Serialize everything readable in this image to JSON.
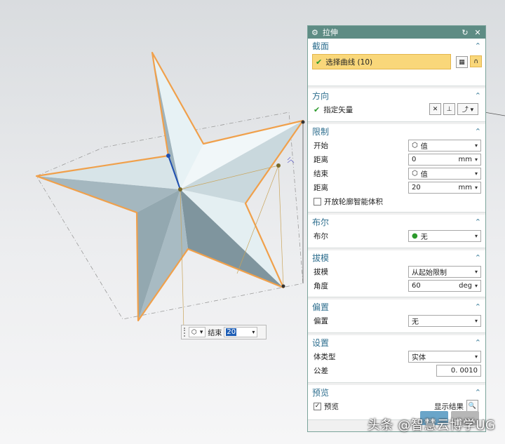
{
  "colors": {
    "title_bar": "#5e8c84",
    "section_header": "#2f6f8f",
    "highlight": "#f9d77a",
    "edge": "#f0a04b",
    "face_light": "#e9f3f6",
    "face_dark": "#8fa5ae"
  },
  "float_box": {
    "type_icon": "cube-icon",
    "label": "结束",
    "value": "20"
  },
  "dialog": {
    "title": "拉伸",
    "sections": {
      "section": {
        "header": "截面",
        "select_curve": "选择曲线 (10)"
      },
      "direction": {
        "header": "方向",
        "vector": "指定矢量"
      },
      "limits": {
        "header": "限制",
        "start_label": "开始",
        "start_value": "值",
        "dist1_label": "距离",
        "dist1_value": "0",
        "dist1_unit": "mm",
        "end_label": "结束",
        "end_value": "值",
        "dist2_label": "距离",
        "dist2_value": "20",
        "dist2_unit": "mm",
        "open_profile": "开放轮廓智能体积"
      },
      "boolean": {
        "header": "布尔",
        "label": "布尔",
        "value": "无"
      },
      "draft": {
        "header": "拔模",
        "label": "拔模",
        "value": "从起始限制",
        "angle_label": "角度",
        "angle_value": "60",
        "angle_unit": "deg"
      },
      "offset": {
        "header": "偏置",
        "label": "偏置",
        "value": "无"
      },
      "settings": {
        "header": "设置",
        "body_type_label": "体类型",
        "body_type_value": "实体",
        "tolerance_label": "公差",
        "tolerance_value": "0. 0010"
      },
      "preview": {
        "header": "预览",
        "checkbox_label": "预览",
        "show_result": "显示结果"
      }
    }
  },
  "watermark": "头条 @智慧云博学UG"
}
